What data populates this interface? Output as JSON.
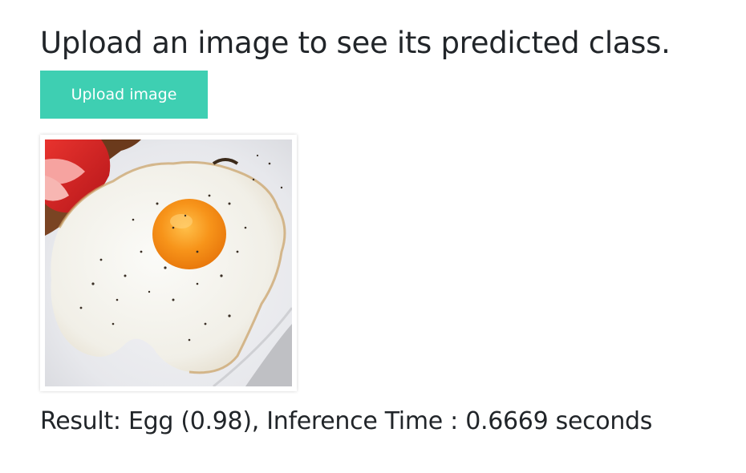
{
  "page": {
    "title": "Upload an image to see its predicted class."
  },
  "upload": {
    "button_label": "Upload image"
  },
  "preview": {
    "alt": "Uploaded image preview"
  },
  "result": {
    "text": "Result: Egg (0.98), Inference Time : 0.6669 seconds"
  },
  "colors": {
    "accent": "#3ecfb2",
    "text": "#212529"
  }
}
